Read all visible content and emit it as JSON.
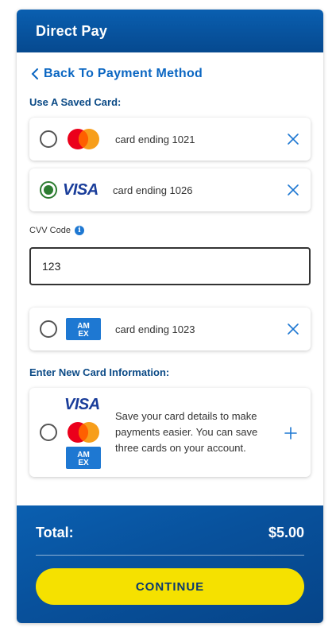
{
  "header": {
    "title": "Direct Pay"
  },
  "back_link": {
    "label": "Back To Payment Method"
  },
  "saved_cards": {
    "section_label": "Use A Saved Card:",
    "cards": [
      {
        "brand": "mastercard",
        "label": "card ending 1021",
        "selected": false
      },
      {
        "brand": "visa",
        "label": "card ending 1026",
        "selected": true
      },
      {
        "brand": "amex",
        "label": "card ending 1023",
        "selected": false
      }
    ]
  },
  "cvv": {
    "label": "CVV Code",
    "value": "123",
    "info_icon": "info-icon"
  },
  "new_card": {
    "section_label": "Enter New Card Information:",
    "description": "Save your card details to make payments easier. You can save three cards on your account.",
    "icon": "plus-icon"
  },
  "footer": {
    "total_label": "Total:",
    "total_value": "$5.00",
    "continue_label": "CONTINUE"
  },
  "brand_logos": {
    "visa": "VISA",
    "amex_line1": "AM",
    "amex_line2": "EX"
  },
  "colors": {
    "header_blue": "#0a5fb0",
    "link_blue": "#0a66c2",
    "section_label": "#0b4a86",
    "selected_green": "#2e7d32",
    "continue_yellow": "#f5e100",
    "amex_blue": "#1e78d2"
  }
}
